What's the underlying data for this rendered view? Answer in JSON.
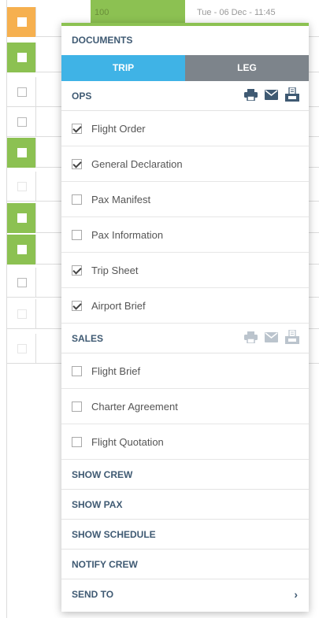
{
  "background": {
    "top_row_cell": "100",
    "top_row_date": "Tue - 06 Dec - 11:45"
  },
  "panel": {
    "header": "DOCUMENTS",
    "tabs": [
      {
        "label": "TRIP",
        "active": true
      },
      {
        "label": "LEG",
        "active": false
      }
    ],
    "ops": {
      "label": "OPS",
      "icons": [
        "print-icon",
        "email-icon",
        "tray-icon"
      ],
      "items": [
        {
          "label": "Flight Order",
          "checked": true
        },
        {
          "label": "General Declaration",
          "checked": true
        },
        {
          "label": "Pax Manifest",
          "checked": false
        },
        {
          "label": "Pax Information",
          "checked": false
        },
        {
          "label": "Trip Sheet",
          "checked": true
        },
        {
          "label": "Airport Brief",
          "checked": true
        }
      ]
    },
    "sales": {
      "label": "SALES",
      "icons": [
        "print-icon",
        "email-icon",
        "tray-icon"
      ],
      "items": [
        {
          "label": "Flight Brief",
          "checked": false
        },
        {
          "label": "Charter Agreement",
          "checked": false
        },
        {
          "label": "Flight Quotation",
          "checked": false
        }
      ]
    },
    "actions": [
      {
        "label": "SHOW CREW"
      },
      {
        "label": "SHOW PAX"
      },
      {
        "label": "SHOW SCHEDULE"
      },
      {
        "label": "NOTIFY CREW"
      },
      {
        "label": "SEND TO",
        "chevron": "›"
      }
    ]
  },
  "colors": {
    "accent_green": "#8cc152",
    "tab_active": "#3fb3e6",
    "tab_inactive": "#7d848b",
    "heading_blue": "#3f5a73"
  }
}
